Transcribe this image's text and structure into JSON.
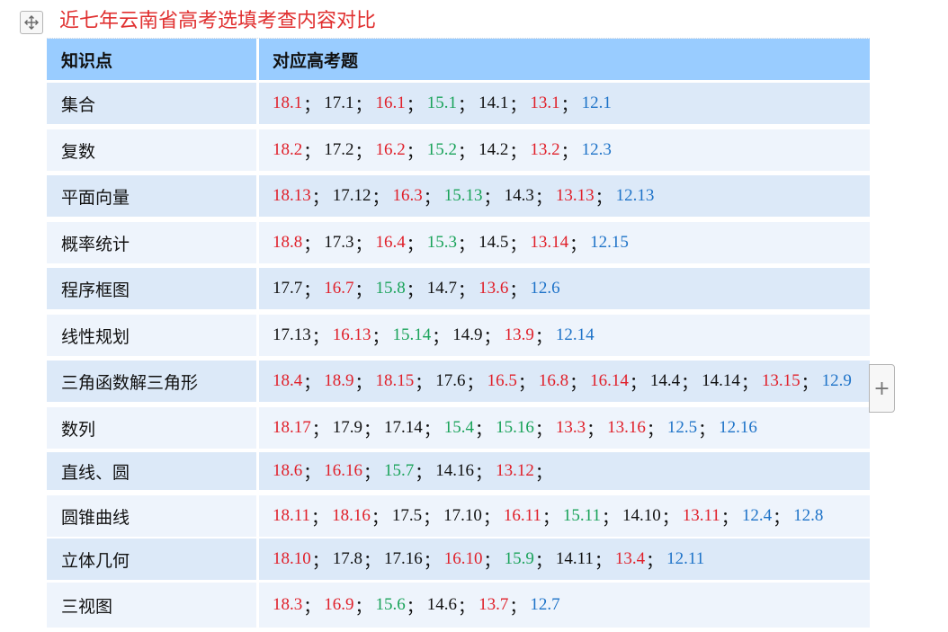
{
  "doc_title": "近七年云南省高考选填考查内容对比",
  "colors": {
    "header_bg": "#99ccff",
    "row_a": "#dce9f8",
    "row_b": "#eef4fc",
    "red": "#e0202a",
    "black": "#111111",
    "green": "#1aa35a",
    "blue": "#1e73c8",
    "title_red": "#e03030"
  },
  "icons": {
    "move_handle": "move-arrows-icon",
    "add_button": "plus-icon"
  },
  "table": {
    "headers": [
      "知识点",
      "对应高考题"
    ],
    "rows": [
      {
        "topic": "集合",
        "refs": [
          {
            "t": "18.1",
            "c": "red"
          },
          {
            "t": "17.1",
            "c": "black"
          },
          {
            "t": "16.1",
            "c": "red"
          },
          {
            "t": "15.1",
            "c": "green"
          },
          {
            "t": "14.1",
            "c": "black"
          },
          {
            "t": "13.1",
            "c": "red"
          },
          {
            "t": "12.1",
            "c": "blue"
          }
        ]
      },
      {
        "topic": "复数",
        "refs": [
          {
            "t": "18.2",
            "c": "red"
          },
          {
            "t": "17.2",
            "c": "black"
          },
          {
            "t": "16.2",
            "c": "red"
          },
          {
            "t": "15.2",
            "c": "green"
          },
          {
            "t": "14.2",
            "c": "black"
          },
          {
            "t": "13.2",
            "c": "red"
          },
          {
            "t": "12.3",
            "c": "blue"
          }
        ]
      },
      {
        "topic": "平面向量",
        "refs": [
          {
            "t": "18.13",
            "c": "red"
          },
          {
            "t": "17.12",
            "c": "black"
          },
          {
            "t": "16.3",
            "c": "red"
          },
          {
            "t": "15.13",
            "c": "green"
          },
          {
            "t": "14.3",
            "c": "black"
          },
          {
            "t": "13.13",
            "c": "red"
          },
          {
            "t": "12.13",
            "c": "blue"
          }
        ]
      },
      {
        "topic": "概率统计",
        "refs": [
          {
            "t": "18.8",
            "c": "red"
          },
          {
            "t": "17.3",
            "c": "black"
          },
          {
            "t": "16.4",
            "c": "red"
          },
          {
            "t": "15.3",
            "c": "green"
          },
          {
            "t": "14.5",
            "c": "black"
          },
          {
            "t": "13.14",
            "c": "red"
          },
          {
            "t": "12.15",
            "c": "blue"
          }
        ]
      },
      {
        "topic": "程序框图",
        "refs": [
          {
            "t": "17.7",
            "c": "black"
          },
          {
            "t": "16.7",
            "c": "red"
          },
          {
            "t": "15.8",
            "c": "green"
          },
          {
            "t": "14.7",
            "c": "black"
          },
          {
            "t": "13.6",
            "c": "red"
          },
          {
            "t": "12.6",
            "c": "blue"
          }
        ]
      },
      {
        "topic": "线性规划",
        "refs": [
          {
            "t": "17.13",
            "c": "black"
          },
          {
            "t": "16.13",
            "c": "red"
          },
          {
            "t": "15.14",
            "c": "green"
          },
          {
            "t": "14.9",
            "c": "black"
          },
          {
            "t": "13.9",
            "c": "red"
          },
          {
            "t": "12.14",
            "c": "blue"
          }
        ]
      },
      {
        "topic": "三角函数解三角形",
        "refs": [
          {
            "t": "18.4",
            "c": "red"
          },
          {
            "t": "18.9",
            "c": "red"
          },
          {
            "t": "18.15",
            "c": "red"
          },
          {
            "t": "17.6",
            "c": "black"
          },
          {
            "t": "16.5",
            "c": "red"
          },
          {
            "t": "16.8",
            "c": "red"
          },
          {
            "t": "16.14",
            "c": "red"
          },
          {
            "t": "14.4",
            "c": "black"
          },
          {
            "t": "14.14",
            "c": "black"
          },
          {
            "t": "13.15",
            "c": "red"
          },
          {
            "t": "12.9",
            "c": "blue"
          }
        ]
      },
      {
        "topic": "数列",
        "refs": [
          {
            "t": "18.17",
            "c": "red"
          },
          {
            "t": "17.9",
            "c": "black"
          },
          {
            "t": "17.14",
            "c": "black"
          },
          {
            "t": "15.4",
            "c": "green"
          },
          {
            "t": "15.16",
            "c": "green"
          },
          {
            "t": "13.3",
            "c": "red"
          },
          {
            "t": "13.16",
            "c": "red"
          },
          {
            "t": "12.5",
            "c": "blue"
          },
          {
            "t": "12.16",
            "c": "blue"
          }
        ]
      },
      {
        "topic": "直线、圆",
        "trailing_sep": true,
        "refs": [
          {
            "t": "18.6",
            "c": "red"
          },
          {
            "t": "16.16",
            "c": "red"
          },
          {
            "t": "15.7",
            "c": "green"
          },
          {
            "t": "14.16",
            "c": "black"
          },
          {
            "t": "13.12",
            "c": "red"
          }
        ]
      },
      {
        "topic": "圆锥曲线",
        "refs": [
          {
            "t": "18.11",
            "c": "red"
          },
          {
            "t": "18.16",
            "c": "red"
          },
          {
            "t": "17.5",
            "c": "black"
          },
          {
            "t": "17.10",
            "c": "black"
          },
          {
            "t": "16.11",
            "c": "red"
          },
          {
            "t": "15.11",
            "c": "green"
          },
          {
            "t": "14.10",
            "c": "black"
          },
          {
            "t": "13.11",
            "c": "red"
          },
          {
            "t": "12.4",
            "c": "blue"
          },
          {
            "t": "12.8",
            "c": "blue"
          }
        ]
      },
      {
        "topic": "立体几何",
        "refs": [
          {
            "t": "18.10",
            "c": "red"
          },
          {
            "t": "17.8",
            "c": "black"
          },
          {
            "t": "17.16",
            "c": "black"
          },
          {
            "t": "16.10",
            "c": "red"
          },
          {
            "t": "15.9",
            "c": "green"
          },
          {
            "t": "14.11",
            "c": "black"
          },
          {
            "t": "13.4",
            "c": "red"
          },
          {
            "t": "12.11",
            "c": "blue"
          }
        ]
      },
      {
        "topic": "三视图",
        "refs": [
          {
            "t": "18.3",
            "c": "red"
          },
          {
            "t": "16.9",
            "c": "red"
          },
          {
            "t": "15.6",
            "c": "green"
          },
          {
            "t": "14.6",
            "c": "black"
          },
          {
            "t": "13.7",
            "c": "red"
          },
          {
            "t": "12.7",
            "c": "blue"
          }
        ]
      }
    ]
  }
}
